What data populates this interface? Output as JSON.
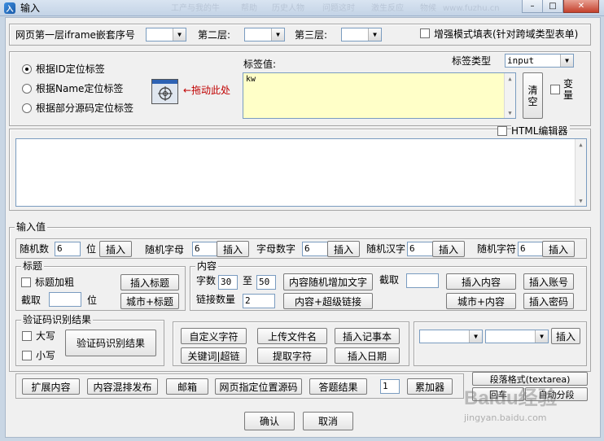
{
  "window": {
    "title": "输入",
    "bg_tabs": [
      "工产与我的牛",
      "帮助",
      "历史人物",
      "问题这时",
      "激生反应",
      "物候",
      "www.fuzhu.cn"
    ],
    "controls": [
      "–",
      "□",
      "✕"
    ]
  },
  "iframe_row": {
    "label1": "网页第一层iframe嵌套序号",
    "label2": "第二层:",
    "label3": "第三层:",
    "enhanced_checkbox": "增强模式填表(针对跨域类型表单)"
  },
  "locate": {
    "radio_id": "根据ID定位标签",
    "radio_name": "根据Name定位标签",
    "radio_src": "根据部分源码定位标签",
    "drag_hint": "←拖动此处",
    "tag_value_label": "标签值:",
    "tag_type_label": "标签类型",
    "tag_type_value": "input",
    "tag_value": "kw",
    "clear_button": "清空",
    "variable_checkbox": "变量"
  },
  "html_editor": {
    "checkbox_label": "HTML编辑器"
  },
  "input_values": {
    "group_title": "输入值",
    "random_num_label": "随机数",
    "random_num_value": "6",
    "unit": "位",
    "insert": "插入",
    "random_letter_label": "随机字母",
    "random_letter_value": "6",
    "letter_digit_label": "字母数字",
    "letter_digit_value": "6",
    "random_hanzi_label": "随机汉字",
    "random_hanzi_value": "6",
    "random_char_label": "随机字符",
    "random_char_value": "6"
  },
  "title_group": {
    "title": "标题",
    "bold_checkbox": "标题加粗",
    "insert_title": "插入标题",
    "cut_label": "截取",
    "unit": "位",
    "city_title": "城市+标题"
  },
  "content_group": {
    "title": "内容",
    "word_count_label": "字数",
    "word_min": "30",
    "to": "至",
    "word_max": "50",
    "random_add": "内容随机增加文字",
    "cut_label": "截取",
    "insert_content": "插入内容",
    "insert_account": "插入账号",
    "link_count_label": "链接数量",
    "link_count": "2",
    "content_link": "内容+超级链接",
    "city_content": "城市+内容",
    "insert_password": "插入密码"
  },
  "captcha_group": {
    "title": "验证码识别结果",
    "upper": "大写",
    "lower": "小写",
    "result_button": "验证码识别结果"
  },
  "misc_buttons": {
    "custom_char": "自定义字符",
    "upload_file": "上传文件名",
    "insert_note": "插入记事本",
    "keyword_link": "关键词|超链",
    "extract_char": "提取字符",
    "insert_date": "插入日期",
    "insert": "插入"
  },
  "bottom_row": {
    "expand": "扩展内容",
    "mixed_publish": "内容混排发布",
    "email": "邮箱",
    "page_source": "网页指定位置源码",
    "answer_result": "答题结果",
    "counter_value": "1",
    "accumulator": "累加器",
    "paragraph_format": "段落格式(textarea)",
    "cr": "回车",
    "auto_split": "自动分段"
  },
  "footer": {
    "ok": "确认",
    "cancel": "取消"
  },
  "watermark": {
    "brand": "Baidu经验",
    "url": "jingyan.baidu.com"
  }
}
